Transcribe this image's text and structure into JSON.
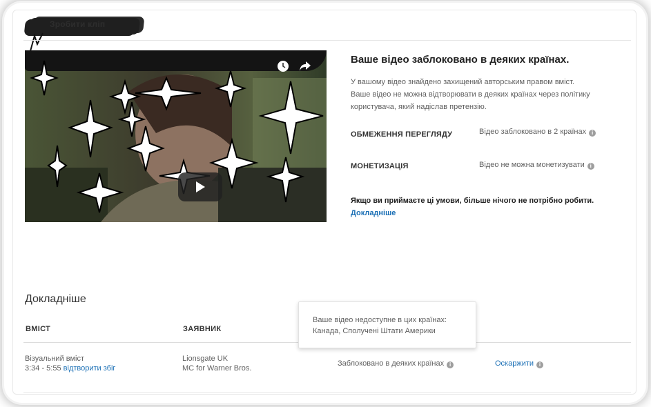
{
  "header": {
    "clip_label": "Зробити кліп"
  },
  "video": {
    "controls": {
      "watch_later_icon": "clock-icon",
      "share_icon": "share-arrow-icon",
      "play_icon": "play-icon"
    }
  },
  "info": {
    "title": "Ваше відео заблоковано в деяких країнах.",
    "description_line1": "У вашому відео знайдено захищений авторським правом вміст.",
    "description_line2": "Ваше відео не можна відтворювати в деяких країнах через політику",
    "description_line3": "користувача, який надіслав претензію.",
    "restriction_label": "ОБМЕЖЕННЯ ПЕРЕГЛЯДУ",
    "restriction_value": "Відео заблоковано в 2 країнах",
    "monetization_label": "МОНЕТИЗАЦІЯ",
    "monetization_value": "Відео не можна монетизувати",
    "accept_text": "Якщо ви приймаєте ці умови, більше нічого не потрібно робити.",
    "learn_more": "Докладніше"
  },
  "details": {
    "title": "Докладніше",
    "columns": {
      "content": "ВМІСТ",
      "claimant": "ЗАЯВНИК"
    },
    "row": {
      "content_type": "Візуальний вміст",
      "time_range": "3:34 - 5:55",
      "play_match": "відтворити збіг",
      "claimant_line1": "Lionsgate UK",
      "claimant_line2": "MC for Warner Bros.",
      "status": "Заблоковано в деяких країнах",
      "dispute": "Оскаржити"
    },
    "tooltip": {
      "line1": "Ваше відео недоступне в цих країнах:",
      "line2": "Канада, Сполучені Штати Америки"
    }
  },
  "colors": {
    "link": "#1a6fb5",
    "sparkle_fill": "#ffffff",
    "sparkle_stroke": "#000000"
  }
}
